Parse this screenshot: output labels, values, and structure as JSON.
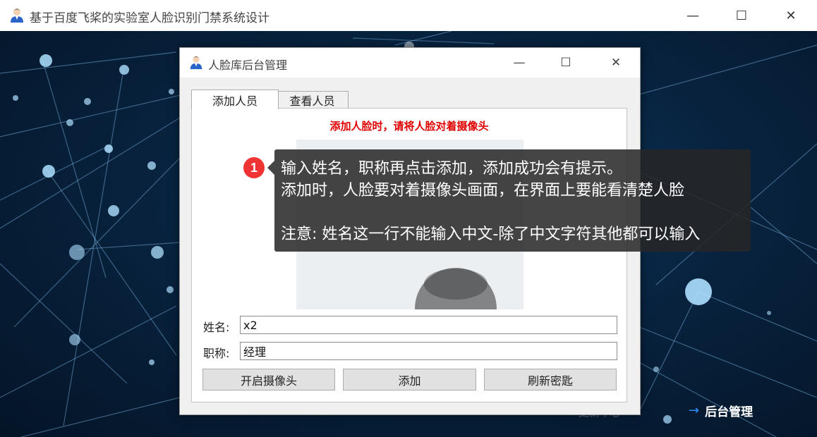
{
  "main_window": {
    "title": "基于百度飞桨的实验室人脸识别门禁系统设计",
    "minimize_glyph": "—",
    "maximize_glyph": "☐",
    "close_glyph": "✕"
  },
  "background_nav": {
    "ghost_label": "更新中心",
    "admin_link_arrow": "→",
    "admin_link_label": "后台管理"
  },
  "dialog": {
    "title": "人脸库后台管理",
    "tabs": [
      {
        "label": "添加人员",
        "active": true
      },
      {
        "label": "查看人员",
        "active": false
      }
    ],
    "notice": "添加人脸时，请将人脸对着摄像头",
    "form": {
      "name_label": "姓名:",
      "name_value": "x2",
      "title_label": "职称:",
      "title_value": "经理"
    },
    "buttons": {
      "open_camera": "开启摄像头",
      "add": "添加",
      "refresh_key": "刷新密匙"
    }
  },
  "tooltip": {
    "step_number": "1",
    "line1": "输入姓名，职称再点击添加，添加成功会有提示。",
    "line2": "添加时，人脸要对着摄像头画面，在界面上要能看清楚人脸",
    "line3": "注意: 姓名这一行不能输入中文-除了中文字符其他都可以输入"
  },
  "icons": {
    "app": "user-avatar-icon",
    "arrow": "right-arrow-icon"
  },
  "colors": {
    "notice_red": "#e00000",
    "step_badge": "#f03434",
    "link_arrow": "#2f8fff",
    "background_dark": "#041427"
  }
}
